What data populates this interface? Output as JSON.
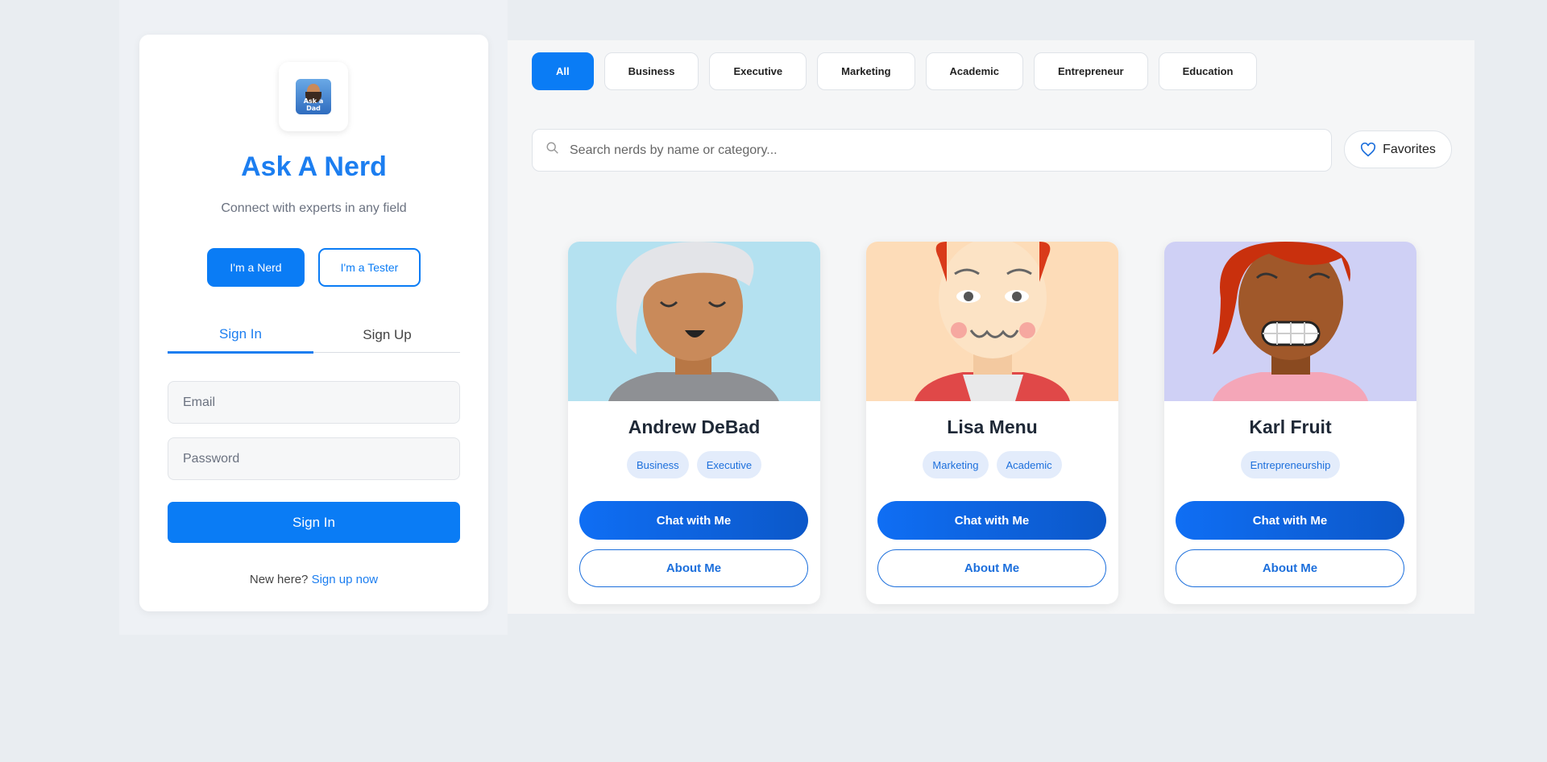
{
  "auth": {
    "logo_alt": "Ask a Dad",
    "brand_title": "Ask A Nerd",
    "brand_subtitle": "Connect with experts in any field",
    "role_nerd": "I'm a Nerd",
    "role_tester": "I'm a Tester",
    "tabs": {
      "sign_in": "Sign In",
      "sign_up": "Sign Up"
    },
    "email_placeholder": "Email",
    "password_placeholder": "Password",
    "submit_label": "Sign In",
    "new_here": "New here?",
    "signup_link": "Sign up now"
  },
  "filters": {
    "chips": [
      "All",
      "Business",
      "Executive",
      "Marketing",
      "Academic",
      "Entrepreneur",
      "Education"
    ],
    "active": "All"
  },
  "search": {
    "placeholder": "Search nerds by name or category...",
    "favorites_label": "Favorites"
  },
  "nerds": [
    {
      "name": "Andrew DeBad",
      "tags": [
        "Business",
        "Executive"
      ],
      "chat_label": "Chat with Me",
      "about_label": "About Me",
      "bg_color": "#b4e1f0"
    },
    {
      "name": "Lisa Menu",
      "tags": [
        "Marketing",
        "Academic"
      ],
      "chat_label": "Chat with Me",
      "about_label": "About Me",
      "bg_color": "#fddcb8"
    },
    {
      "name": "Karl Fruit",
      "tags": [
        "Entrepreneurship"
      ],
      "chat_label": "Chat with Me",
      "about_label": "About Me",
      "bg_color": "#cfd0f5"
    }
  ],
  "colors": {
    "accent": "#0a7cf5",
    "tag_bg": "#e3ecfb"
  }
}
